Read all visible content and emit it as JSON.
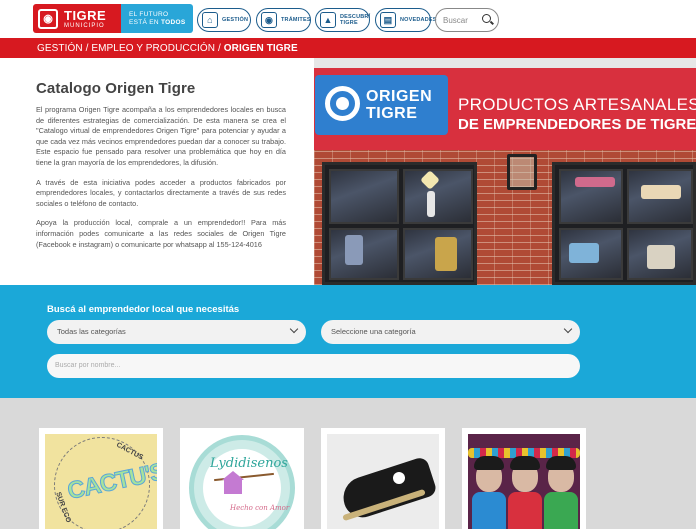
{
  "header": {
    "logo_title": "TIGRE",
    "logo_subtitle": "MUNICIPIO",
    "slogan_line1": "EL FUTURO",
    "slogan_line2": "ESTÁ EN",
    "slogan_bold": "TODOS",
    "nav": [
      {
        "label": "GESTIÓN",
        "icon": "building-icon"
      },
      {
        "label": "TRÁMITES",
        "icon": "car-icon"
      },
      {
        "label": "DESCUBRÍ TIGRE",
        "icon": "museum-icon"
      },
      {
        "label": "NOVEDADES",
        "icon": "newspaper-icon"
      }
    ],
    "search_placeholder": "Buscar"
  },
  "breadcrumb": {
    "path": "GESTIÓN / EMPLEO Y PRODUCCIÓN / ",
    "current": "ORIGEN TIGRE"
  },
  "intro": {
    "title": "Catalogo Origen Tigre",
    "p1": "El programa Origen Tigre acompaña a los emprendedores locales en busca de diferentes estrategias de comercialización. De esta manera se crea el \"Catalogo virtual de emprendedores Origen Tigre\" para potenciar y ayudar a que cada vez más vecinos emprendedores puedan dar a conocer su trabajo. Este espacio fue pensado para resolver una problemática que hoy en día tiene la gran mayoría de los emprendedores, la difusión.",
    "p2": "A través de esta iniciativa podes acceder a productos fabricados por emprendedores locales, y contactarlos directamente a través de sus redes sociales o teléfono de contacto.",
    "p3": "Apoya la producción local, comprale a un emprendedor!! Para más información podes comunicarte a las redes sociales de Origen Tigre (Facebook e instagram) o comunicarte por whatsapp al 155-124-4016"
  },
  "hero": {
    "sign_logo_line1": "ORIGEN",
    "sign_logo_line2": "TIGRE",
    "sign_text1": "PRODUCTOS ARTESANALES",
    "sign_text2": "DE EMPRENDEDORES DE TIGRE"
  },
  "filters": {
    "label": "Buscá al emprendedor local que necesitás",
    "select1_value": "Todas las categorías",
    "select2_value": "Seleccione una categoría",
    "name_placeholder": "Buscar por nombre..."
  },
  "cards": [
    {
      "image_text": "CACTU'S",
      "small_top": "CACTUS",
      "small_side": "SUR ECO"
    },
    {
      "image_text": "Lydidisenos",
      "small": "Hecho con Amor"
    },
    {
      "image_text": ""
    },
    {
      "image_text": ""
    }
  ],
  "colors": {
    "brand_red": "#d71920",
    "brand_blue": "#29a6d8",
    "nav_blue": "#1c5c8c",
    "search_band": "#1ba8d8",
    "cards_bg": "#d9d9d9"
  }
}
